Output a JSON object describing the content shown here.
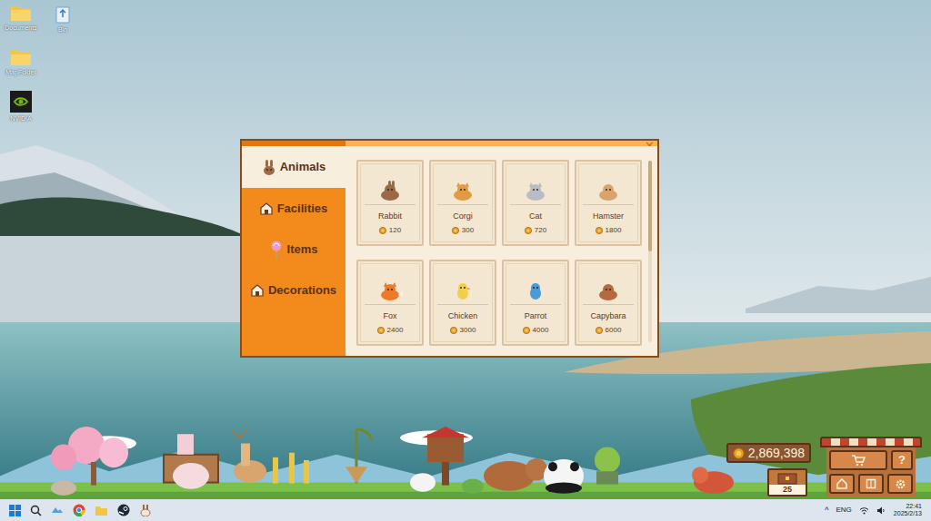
{
  "desktop_icons": [
    {
      "label": "Documents",
      "kind": "folder"
    },
    {
      "label": "Bin",
      "kind": "bin"
    },
    {
      "label": "MapFolder",
      "kind": "folder"
    },
    {
      "label": "NVIDIA",
      "kind": "app"
    }
  ],
  "shop": {
    "close": "✕",
    "tabs": [
      {
        "label": "Animals",
        "selected": true
      },
      {
        "label": "Facilities",
        "selected": false
      },
      {
        "label": "Items",
        "selected": false
      },
      {
        "label": "Decorations",
        "selected": false
      }
    ],
    "items": [
      {
        "name": "Rabbit",
        "price": "120",
        "color": "#9a6a46"
      },
      {
        "name": "Corgi",
        "price": "300",
        "color": "#e39a45"
      },
      {
        "name": "Cat",
        "price": "720",
        "color": "#b9bcc4"
      },
      {
        "name": "Hamster",
        "price": "1800",
        "color": "#d9a46c"
      },
      {
        "name": "Fox",
        "price": "2400",
        "color": "#ec7a2a"
      },
      {
        "name": "Chicken",
        "price": "3000",
        "color": "#f2cf4a"
      },
      {
        "name": "Parrot",
        "price": "4000",
        "color": "#4a9ad8"
      },
      {
        "name": "Capybara",
        "price": "6000",
        "color": "#b4693e"
      }
    ],
    "scrollbar": {
      "level": 0.5
    }
  },
  "game": {
    "coins": "2,869,398",
    "badge": "25",
    "help": "?"
  },
  "taskbar": {
    "tray_arrow": "^",
    "language": "ENG",
    "time": "22:41",
    "date": "2025/2/13"
  }
}
